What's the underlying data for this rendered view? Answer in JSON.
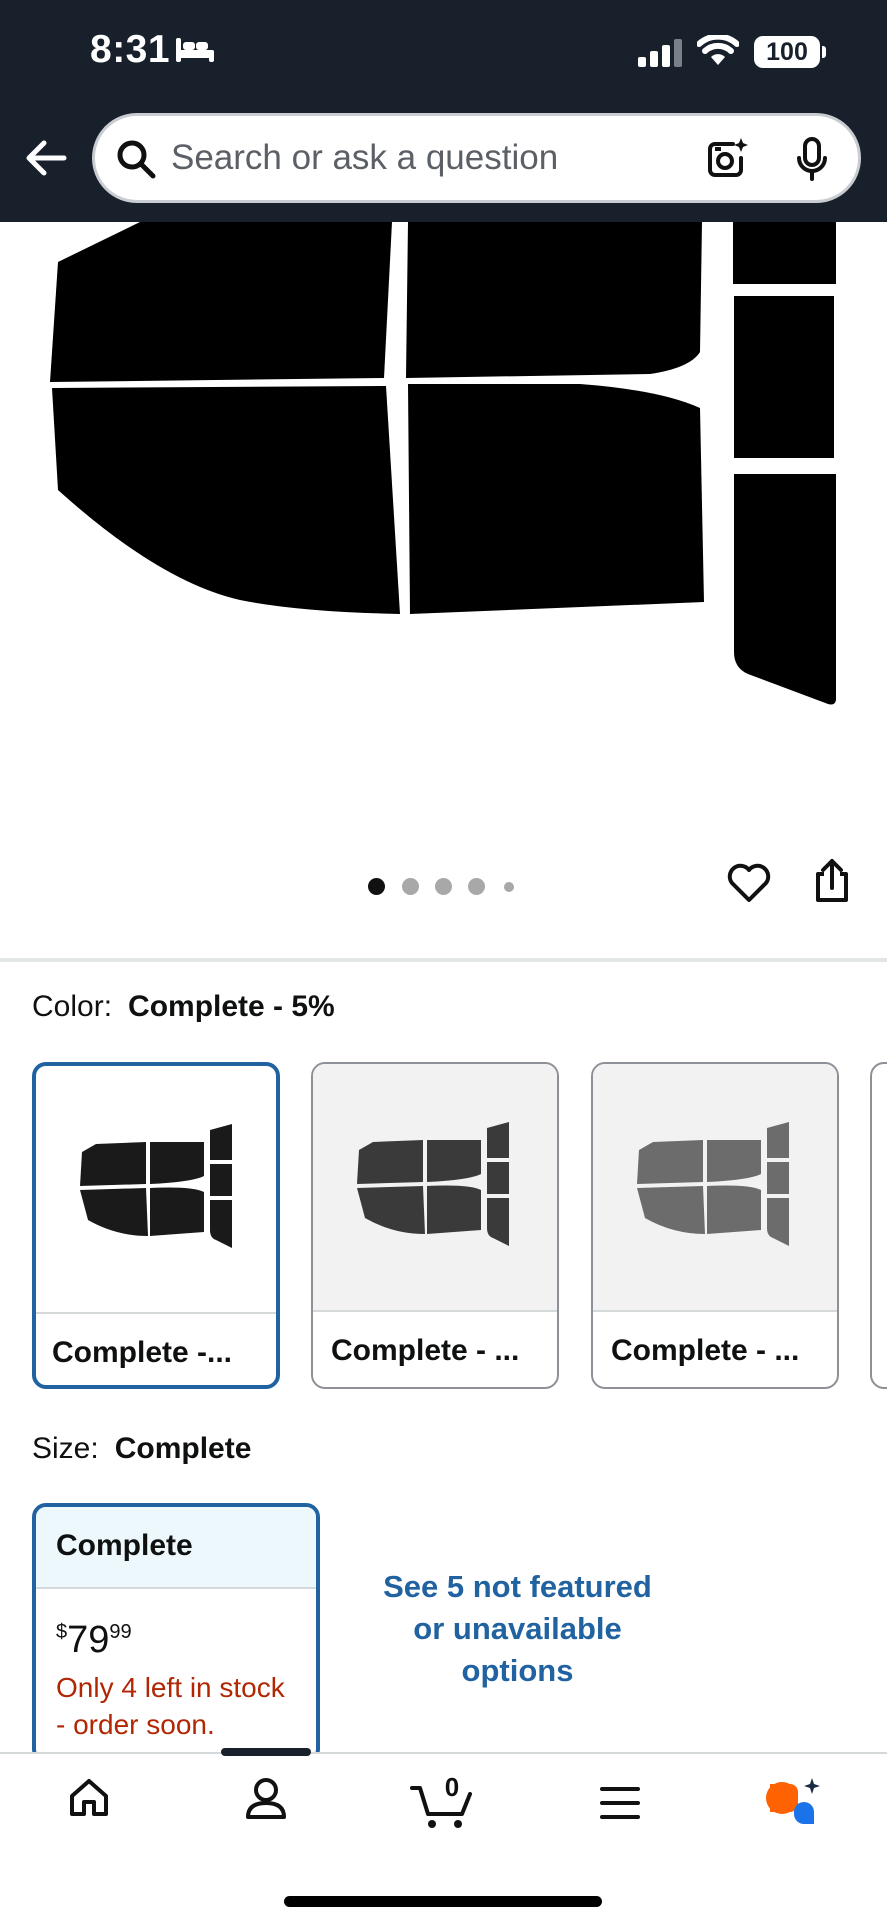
{
  "status_bar": {
    "time": "8:31",
    "battery": "100"
  },
  "search": {
    "placeholder": "Search or ask a question"
  },
  "carousel": {
    "dot_count": 5,
    "active_index": 0
  },
  "color": {
    "label": "Color:",
    "value": "Complete - 5%",
    "options": [
      {
        "caption": "Complete -...",
        "tint": "#1a1a1a",
        "selected": true
      },
      {
        "caption": "Complete - ...",
        "tint": "#3a3a3a",
        "selected": false
      },
      {
        "caption": "Complete - ...",
        "tint": "#6c6c6c",
        "selected": false
      }
    ]
  },
  "size": {
    "label": "Size:",
    "value": "Complete",
    "card": {
      "title": "Complete",
      "price_symbol": "$",
      "price_whole": "79",
      "price_fraction": "99",
      "stock_line1": "Only 4 left in stock",
      "stock_line2": "- order soon."
    },
    "see_more_line1": "See 5 not featured",
    "see_more_line2": "or unavailable",
    "see_more_line3": "options"
  },
  "bottom_nav": {
    "cart_count": "0",
    "items": [
      "home-icon",
      "account-icon",
      "cart-icon",
      "menu-icon",
      "rufus-ai-icon"
    ]
  },
  "colors": {
    "header_bg": "#18202c",
    "link_blue": "#2162a1",
    "stock_red": "#b12704",
    "selected_border": "#2162a1"
  }
}
